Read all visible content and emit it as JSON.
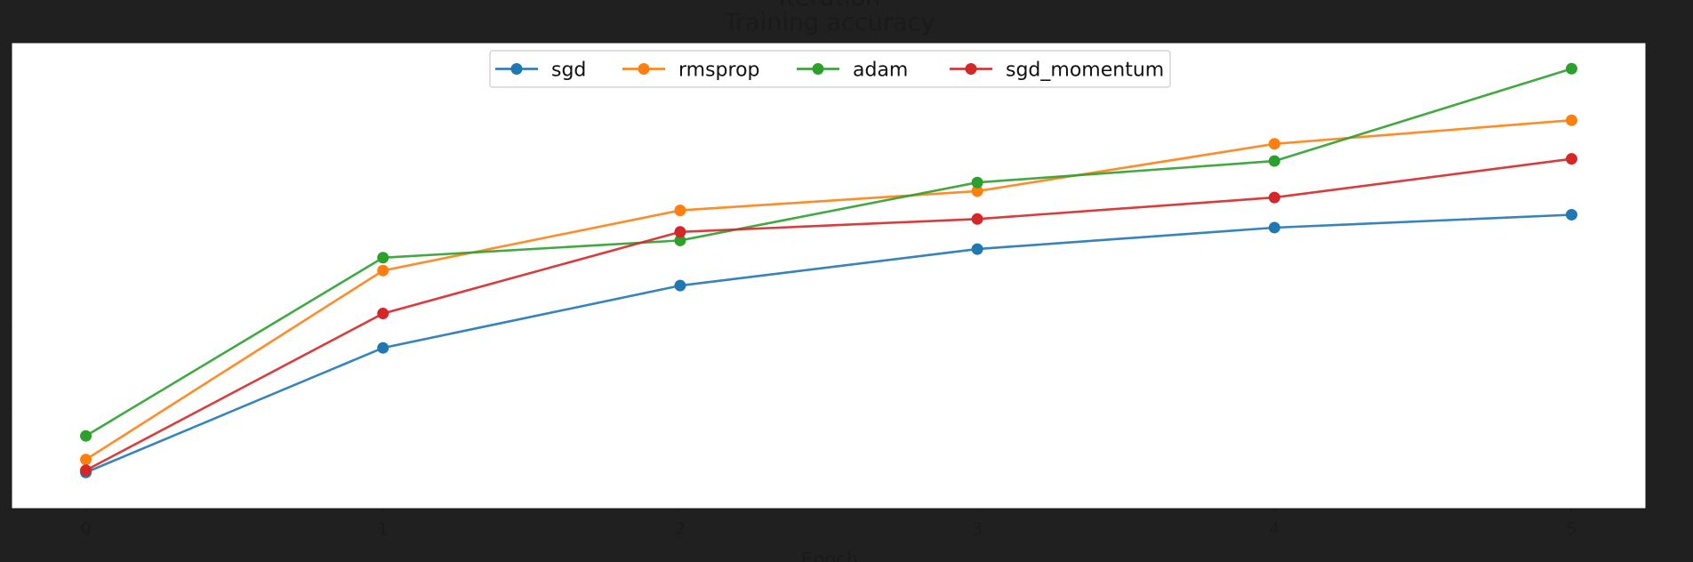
{
  "chart_data": {
    "type": "line",
    "title": "Training accuracy",
    "top_clipped_label": "Iteration",
    "xlabel": "Epoch",
    "ylabel": "",
    "x": [
      0,
      1,
      2,
      3,
      4,
      5
    ],
    "xlim": [
      -0.25,
      5.25
    ],
    "ylim": [
      0,
      1
    ],
    "y_ticks_shown": false,
    "grid": false,
    "legend_placement": "top-center",
    "legend_columns": 4,
    "series": [
      {
        "name": "sgd",
        "color": "#1f77b4",
        "values": [
          0.045,
          0.335,
          0.48,
          0.565,
          0.615,
          0.645
        ]
      },
      {
        "name": "rmsprop",
        "color": "#ff7f0e",
        "values": [
          0.075,
          0.515,
          0.655,
          0.7,
          0.81,
          0.865
        ]
      },
      {
        "name": "adam",
        "color": "#2ca02c",
        "values": [
          0.13,
          0.545,
          0.585,
          0.72,
          0.77,
          0.985
        ]
      },
      {
        "name": "sgd_momentum",
        "color": "#d62728",
        "values": [
          0.05,
          0.415,
          0.605,
          0.635,
          0.685,
          0.775
        ]
      }
    ]
  }
}
